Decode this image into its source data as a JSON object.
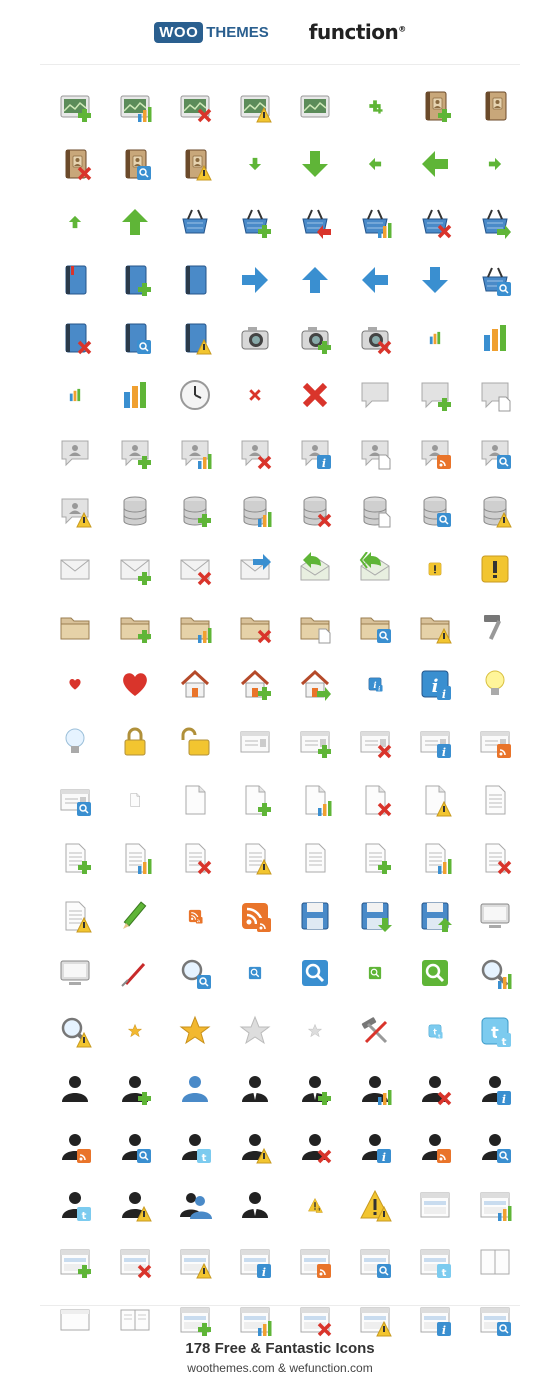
{
  "header": {
    "brand_left_badge": "WOO",
    "brand_left_rest": "THEMES",
    "brand_right": "function",
    "brand_right_mark": "®"
  },
  "footer": {
    "title": "178 Free & Fantastic Icons",
    "subtitle": "woothemes.com & wefunction.com"
  },
  "colors": {
    "green": "#5fb537",
    "red": "#d9342b",
    "blue": "#3a8fd0",
    "yellow": "#f2c530",
    "orange": "#e9742a",
    "dark": "#333333",
    "brand": "#2a5f8f"
  },
  "icons": [
    "image-add",
    "image-chart",
    "image-delete",
    "image-warning",
    "image",
    "add-small",
    "contact-book-add",
    "contact-book",
    "contact-book-delete",
    "contact-book-search",
    "contact-book-warning",
    "arrow-down-small",
    "arrow-down",
    "arrow-left-small",
    "arrow-left",
    "arrow-right-small",
    "arrow-up-small",
    "arrow-up",
    "basket",
    "basket-add",
    "basket-remove",
    "basket-chart",
    "basket-delete",
    "basket-go",
    "book",
    "book-add",
    "book-blue",
    "arrow-right",
    "arrow-up-blue",
    "arrow-left-blue",
    "arrow-down-blue",
    "basket-search",
    "book-delete",
    "book-search",
    "book-warning",
    "camera",
    "camera-add",
    "camera-delete",
    "chart-small",
    "chart",
    "chart-small-2",
    "chart-2",
    "clock",
    "close-small",
    "close",
    "comment",
    "comment-add",
    "comment-page",
    "comment-user",
    "comment-user-add",
    "comment-user-chart",
    "comment-user-delete",
    "comment-user-info",
    "comment-user-page",
    "comment-user-rss",
    "comment-user-search",
    "comment-user-warning",
    "database",
    "database-add",
    "database-chart",
    "database-delete",
    "database-page",
    "database-search",
    "database-warning",
    "mail",
    "mail-add",
    "mail-delete",
    "mail-forward",
    "mail-reply",
    "mail-reply-all",
    "exclamation-small",
    "exclamation",
    "folder",
    "folder-add",
    "folder-chart",
    "folder-delete",
    "folder-page",
    "folder-search",
    "folder-warning",
    "hammer",
    "heart-small",
    "heart",
    "home",
    "home-add",
    "home-go",
    "info-small",
    "info",
    "lightbulb-on",
    "lightbulb",
    "lock",
    "unlock",
    "card",
    "card-add",
    "card-delete",
    "card-info",
    "card-rss",
    "card-search",
    "page-small",
    "page",
    "page-add",
    "page-chart",
    "page-delete",
    "page-warning",
    "page-lines",
    "page-lines-add",
    "page-lines-chart",
    "page-lines-delete",
    "page-lines-warning",
    "page-lines-2",
    "page-lines-add-2",
    "page-lines-chart-2",
    "page-lines-delete-2",
    "page-lines-warning-2",
    "pencil",
    "rss-small",
    "rss",
    "save",
    "save-down",
    "save-up",
    "monitor",
    "monitor-2",
    "screwdriver",
    "search",
    "search-blue-small",
    "search-blue",
    "search-green-small",
    "search-green",
    "search-chart",
    "search-warning",
    "star-small",
    "star",
    "star-grey",
    "star-grey-small",
    "tools",
    "twitter-small",
    "twitter",
    "user",
    "user-add",
    "user-blue",
    "user-suit",
    "user-suit-add",
    "user-chart",
    "user-delete",
    "user-info",
    "user-rss",
    "user-search",
    "user-twitter",
    "user-warning",
    "user-delete-2",
    "user-info-2",
    "user-rss-2",
    "user-search-2",
    "user-twitter-2",
    "user-warning-2",
    "users",
    "user-suit-2",
    "warning-small",
    "warning",
    "window",
    "window-chart",
    "window-add",
    "window-delete",
    "window-warning",
    "window-info",
    "window-rss",
    "window-search",
    "window-twitter",
    "window-split",
    "window-blank",
    "window-columns",
    "window-add-2",
    "window-chart-2",
    "window-delete-2",
    "window-warning-2",
    "window-info-2",
    "window-search-2"
  ]
}
